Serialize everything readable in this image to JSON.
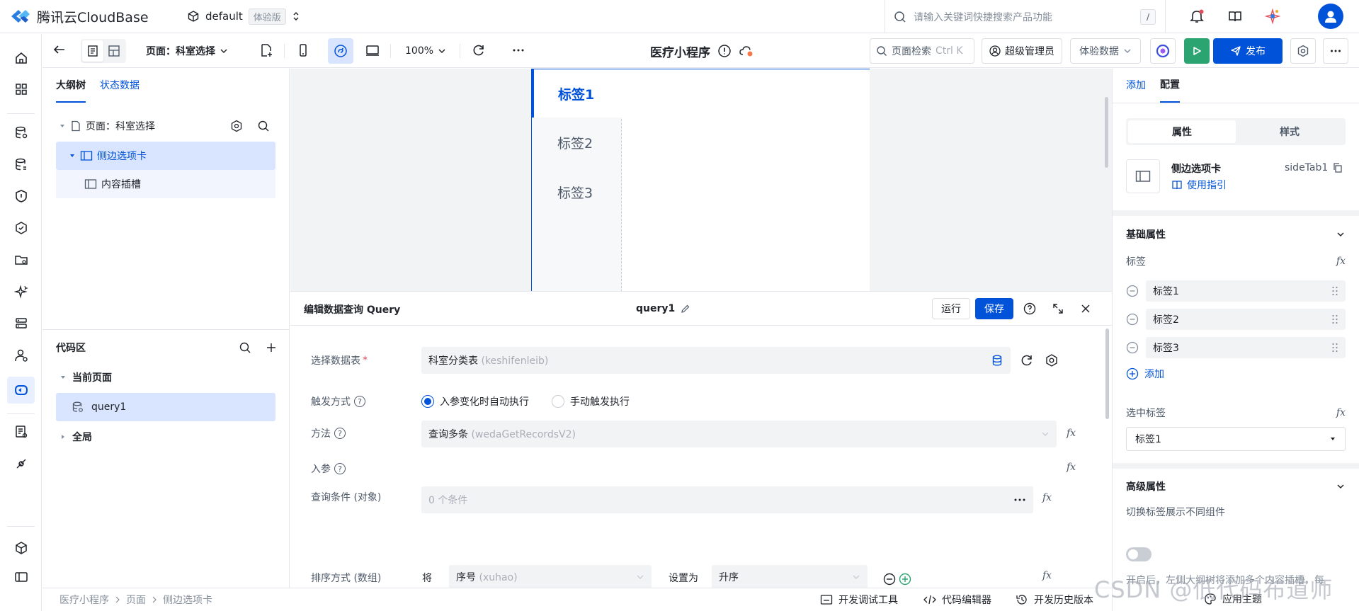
{
  "topbar": {
    "brand": "腾讯云CloudBase",
    "env_name": "default",
    "env_badge": "体验版",
    "search_placeholder": "请输入关键词快捷搜索产品功能",
    "search_shortcut": "/"
  },
  "toolbar": {
    "page_label": "页面：科室选择",
    "zoom": "100%",
    "app_title": "医疗小程序",
    "page_search": "页面检索",
    "page_search_shortcut": "Ctrl K",
    "role": "超级管理员",
    "data_mode": "体验数据",
    "publish": "发布"
  },
  "outline": {
    "tabs": [
      "大纲树",
      "状态数据"
    ],
    "tree": {
      "page": "页面：科室选择",
      "sidetab": "侧边选项卡",
      "slot": "内容插槽"
    }
  },
  "code_area": {
    "title": "代码区",
    "current_page": "当前页面",
    "query_item": "query1",
    "global": "全局"
  },
  "canvas": {
    "tabs": [
      "标签1",
      "标签2",
      "标签3"
    ],
    "active_index": 0
  },
  "query_editor": {
    "title": "编辑数据查询 Query",
    "name": "query1",
    "run": "运行",
    "save": "保存",
    "table_label": "选择数据表",
    "table_value": "科室分类表",
    "table_value_id": "(keshifenleib)",
    "trigger_label": "触发方式",
    "trigger_options": [
      "入参变化时自动执行",
      "手动触发执行"
    ],
    "trigger_selected": 0,
    "method_label": "方法",
    "method_value": "查询多条",
    "method_value_id": "(wedaGetRecordsV2)",
    "params_label": "入参",
    "condition_label": "查询条件 (对象)",
    "condition_value": "0 个条件",
    "sort_label": "排序方式 (数组)",
    "sort_prefix": "将",
    "sort_field": "序号",
    "sort_field_id": "(xuhao)",
    "sort_set_as": "设置为",
    "sort_order": "升序"
  },
  "right_panel": {
    "tabs": [
      "添加",
      "配置"
    ],
    "seg": [
      "属性",
      "样式"
    ],
    "component_name": "侧边选项卡",
    "component_id": "sideTab1",
    "guide": "使用指引",
    "basic_props": "基础属性",
    "tabs_label": "标签",
    "tab_items": [
      "标签1",
      "标签2",
      "标签3"
    ],
    "add": "添加",
    "selected_tab_label": "选中标签",
    "selected_tab_value": "标签1",
    "advanced_props": "高级属性",
    "switch_label": "切换标签展示不同组件",
    "switch_hint": "开启后，左侧大纲树将添加多个内容插槽，每"
  },
  "statusbar": {
    "breadcrumb": [
      "医疗小程序",
      "页面",
      "侧边选项卡"
    ],
    "dev_tools": "开发调试工具",
    "code_editor": "代码编辑器",
    "history": "开发历史版本",
    "theme": "应用主题"
  },
  "watermark": "CSDN @低代码布道师",
  "colors": {
    "accent": "#0052d9",
    "run_green": "#2ba471",
    "selected_bg": "#d9e4ff"
  }
}
